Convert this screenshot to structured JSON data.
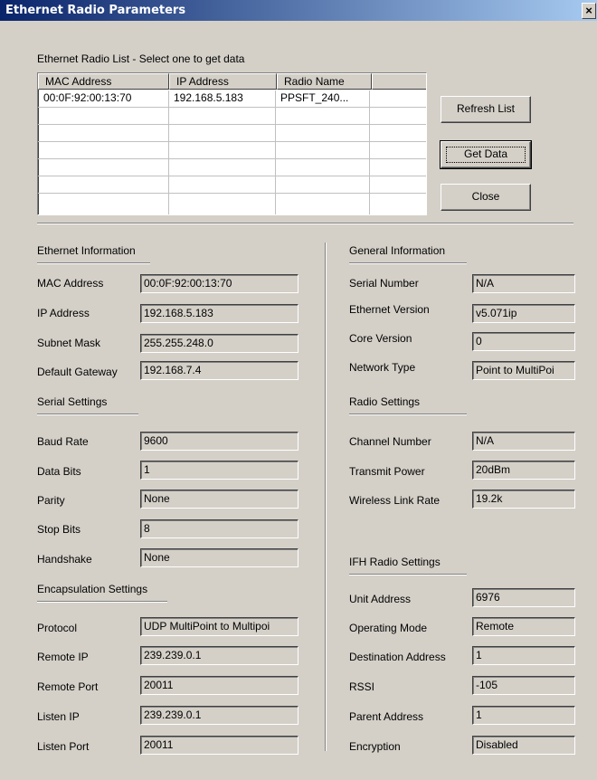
{
  "window": {
    "title": "Ethernet Radio Parameters",
    "close_glyph": "×"
  },
  "list": {
    "caption": "Ethernet Radio List - Select one to get data",
    "columns": [
      "MAC Address",
      "IP Address",
      "Radio Name",
      ""
    ],
    "rows": [
      {
        "mac": "00:0F:92:00:13:70",
        "ip": "192.168.5.183",
        "name": "PPSFT_240..."
      }
    ]
  },
  "buttons": {
    "refresh": "Refresh List",
    "get_data": "Get Data",
    "close": "Close"
  },
  "ethernet": {
    "heading": "Ethernet Information",
    "mac_label": "MAC Address",
    "mac": "00:0F:92:00:13:70",
    "ip_label": "IP Address",
    "ip": "192.168.5.183",
    "subnet_label": "Subnet Mask",
    "subnet": "255.255.248.0",
    "gateway_label": "Default Gateway",
    "gateway": "192.168.7.4"
  },
  "serial": {
    "heading": "Serial Settings",
    "baud_label": "Baud Rate",
    "baud": "9600",
    "databits_label": "Data Bits",
    "databits": "1",
    "parity_label": "Parity",
    "parity": "None",
    "stopbits_label": "Stop Bits",
    "stopbits": "8",
    "handshake_label": "Handshake",
    "handshake": "None"
  },
  "encap": {
    "heading": "Encapsulation Settings",
    "protocol_label": "Protocol",
    "protocol": "UDP MultiPoint to Multipoi",
    "remote_ip_label": "Remote IP",
    "remote_ip": "239.239.0.1",
    "remote_port_label": "Remote Port",
    "remote_port": "20011",
    "listen_ip_label": "Listen IP",
    "listen_ip": "239.239.0.1",
    "listen_port_label": "Listen Port",
    "listen_port": "20011"
  },
  "general": {
    "heading": "General Information",
    "serial_label": "Serial Number",
    "serial": "N/A",
    "eth_ver_label": "Ethernet Version",
    "eth_ver": "v5.071ip",
    "core_ver_label": "Core Version",
    "core_ver": "0",
    "net_type_label": "Network Type",
    "net_type": "Point to MultiPoi"
  },
  "radio": {
    "heading": "Radio Settings",
    "channel_label": "Channel Number",
    "channel": "N/A",
    "power_label": "Transmit Power",
    "power": "20dBm",
    "link_rate_label": "Wireless Link Rate",
    "link_rate": "19.2k"
  },
  "ifh": {
    "heading": "IFH Radio Settings",
    "unit_label": "Unit Address",
    "unit": "6976",
    "mode_label": "Operating Mode",
    "mode": "Remote",
    "dest_label": "Destination Address",
    "dest": "1",
    "rssi_label": "RSSI",
    "rssi": "-105",
    "parent_label": "Parent Address",
    "parent": "1",
    "enc_label": "Encryption",
    "enc": "Disabled"
  }
}
